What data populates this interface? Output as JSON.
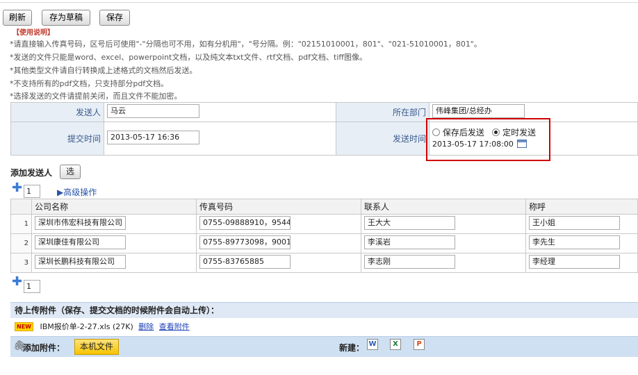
{
  "toolbar": {
    "refresh": "刷新",
    "save_draft": "存为草稿",
    "save": "保存"
  },
  "instructions": {
    "title": "使用说明",
    "lines": [
      "*请直接输入传真号码，区号后可使用\"-\"分隔也可不用，如有分机用\"，\"号分隔。例：\"02151010001，801\"、\"021-51010001，801\"。",
      "*发送的文件只能是word、excel、powerpoint文档，以及纯文本txt文件、rtf文档、pdf文档、tiff图像。",
      "*其他类型文件请自行转换成上述格式的文档然后发送。",
      "*不支持所有的pdf文档，只支持部分pdf文档。",
      "*选择发送的文件请提前关闭，而且文件不能加密。"
    ]
  },
  "form": {
    "sender_label": "发送人",
    "sender_value": "马云",
    "dept_label": "所在部门",
    "dept_value": "伟峰集团/总经办",
    "submit_label": "提交时间",
    "submit_value": "2013-05-17 16:36",
    "send_label": "发送时间",
    "radio_after_save": "保存后发送",
    "radio_scheduled": "定时发送",
    "scheduled_value": "2013-05-17 17:08:00"
  },
  "recipients": {
    "add_label": "添加发送人",
    "select_button": "选",
    "count_top": "1",
    "advanced": "高级操作",
    "count_bottom": "1",
    "headers": [
      "公司名称",
      "传真号码",
      "联系人",
      "称呼"
    ],
    "rows": [
      {
        "idx": "1",
        "company": "深圳市伟宏科技有限公司",
        "fax": "0755-09888910，9544",
        "contact": "王大大",
        "title": "王小姐"
      },
      {
        "idx": "2",
        "company": "深圳康佳有限公司",
        "fax": "0755-89773098，9001",
        "contact": "李溪岩",
        "title": "李先生"
      },
      {
        "idx": "3",
        "company": "深圳长鹏科技有限公司",
        "fax": "0755-83765885",
        "contact": "李志刚",
        "title": "李经理"
      }
    ]
  },
  "attachments": {
    "header": "待上传附件（保存、提交文档的时候附件会自动上传）：",
    "new_badge": "NEW",
    "file_name": "IBM报价单-2-27.xls (27K)",
    "delete": "删除",
    "view": "查看附件",
    "add_label": "添加附件：",
    "local_file": "本机文件",
    "new_label": "新建：",
    "icons": [
      "word-icon",
      "excel-icon",
      "powerpoint-icon"
    ]
  }
}
